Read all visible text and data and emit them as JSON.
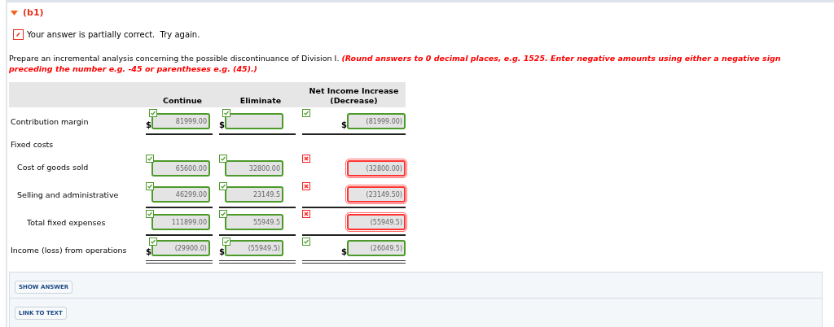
{
  "part": {
    "label": "(b1)",
    "expanded": true
  },
  "feedback": {
    "text": "Your answer is partially correct.  Try again."
  },
  "instructions": {
    "text": "Prepare an incremental analysis concerning the possible discontinuance of Division I. ",
    "note": "(Round answers to 0 decimal places, e.g. 1525. Enter negative amounts using either a negative sign preceding the number e.g. -45 or parentheses e.g. (45).)"
  },
  "table": {
    "columns": [
      {
        "label": "Continue"
      },
      {
        "label": "Eliminate"
      },
      {
        "label": "Net Income Increase (Decrease)"
      }
    ],
    "rows": [
      {
        "label": "Contribution margin",
        "underlined": true,
        "cells": [
          {
            "currency": "$",
            "value": "81999.00",
            "correct": true
          },
          {
            "currency": "$",
            "correct": true
          },
          {
            "currency": "$",
            "value": "(81999.00)",
            "correct": true
          }
        ]
      },
      {
        "label": "Fixed costs",
        "children": [
          {
            "label": "Cost of goods sold",
            "cells": [
              {
                "value": "65600.00",
                "correct": true
              },
              {
                "value": "32800.00",
                "correct": true
              },
              {
                "value": "(32800.00)",
                "correct": false
              }
            ]
          },
          {
            "label": "Selling and administrative",
            "underlined": true,
            "cells": [
              {
                "value": "46299.00",
                "correct": true
              },
              {
                "value": "23149.5",
                "correct": true
              },
              {
                "value": "(23149.50)",
                "correct": false
              }
            ]
          },
          {
            "label": "Total fixed expenses",
            "total": true,
            "underlined": true,
            "cells": [
              {
                "value": "111899.00",
                "correct": true
              },
              {
                "value": "55949.5",
                "correct": true
              },
              {
                "value": "(55949.5)",
                "correct": false
              }
            ]
          }
        ]
      },
      {
        "label": "Income (loss) from operations",
        "double_underlined": true,
        "cells": [
          {
            "currency": "$",
            "value": "(29900.0)",
            "correct": true
          },
          {
            "currency": "$",
            "value": "(55949.5)",
            "correct": true
          },
          {
            "currency": "$",
            "value": "(26049.5)",
            "correct": true
          }
        ]
      }
    ]
  },
  "buttons": [
    {
      "label": "SHOW ANSWER"
    },
    {
      "label": "LINK TO TEXT"
    }
  ]
}
